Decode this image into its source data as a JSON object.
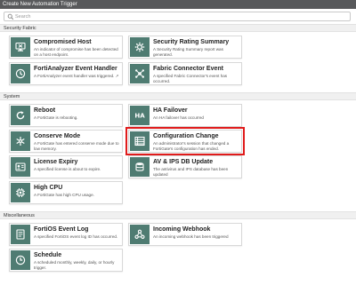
{
  "window": {
    "title": "Create New Automation Trigger"
  },
  "search": {
    "placeholder": "Search"
  },
  "sections": [
    {
      "label": "Security Fabric"
    },
    {
      "label": "System"
    },
    {
      "label": "Miscellaneous"
    }
  ],
  "cards": [
    {
      "title": "Compromised Host",
      "description": "An indicator of compromise has been detected on a host endpoint.",
      "icon": "compromised-host-icon"
    },
    {
      "title": "Security Rating Summary",
      "description": "A Security Rating Summary report was generated.",
      "icon": "security-rating-icon"
    },
    {
      "title": "FortiAnalyzer Event Handler",
      "description": "A FortiAnalyzer event handler was triggered. ↗",
      "icon": "fortianalyzer-icon"
    },
    {
      "title": "Fabric Connector Event",
      "description": "A specified Fabric Connector's event has occurred.",
      "icon": "fabric-connector-icon"
    },
    {
      "title": "Reboot",
      "description": "A FortiGate is rebooting.",
      "icon": "reboot-icon"
    },
    {
      "title": "HA Failover",
      "description": "An HA failover has occurred",
      "icon": "ha-failover-icon"
    },
    {
      "title": "Conserve Mode",
      "description": "A FortiGate has entered conserve mode due to low memory.",
      "icon": "conserve-mode-icon"
    },
    {
      "title": "Configuration Change",
      "description": "An administrator's session that changed a FortiGate's configuration has ended.",
      "icon": "configuration-change-icon"
    },
    {
      "title": "License Expiry",
      "description": "A specified license is about to expire.",
      "icon": "license-expiry-icon"
    },
    {
      "title": "AV & IPS DB Update",
      "description": "The antivirus and IPS database has been updated",
      "icon": "av-ips-update-icon"
    },
    {
      "title": "High CPU",
      "description": "A FortiGate has high CPU usage.",
      "icon": "high-cpu-icon"
    },
    {
      "title": "FortiOS Event Log",
      "description": "A specified FortiOS event log ID has occurred.",
      "icon": "event-log-icon"
    },
    {
      "title": "Incoming Webhook",
      "description": "An incoming webhook has been triggered",
      "icon": "webhook-icon"
    },
    {
      "title": "Schedule",
      "description": "A scheduled monthly, weekly, daily, or hourly trigger.",
      "icon": "schedule-icon"
    }
  ],
  "colors": {
    "icon_bg": "#4f7c72",
    "highlight": "#e01b1b",
    "titlebar": "#58595b"
  }
}
